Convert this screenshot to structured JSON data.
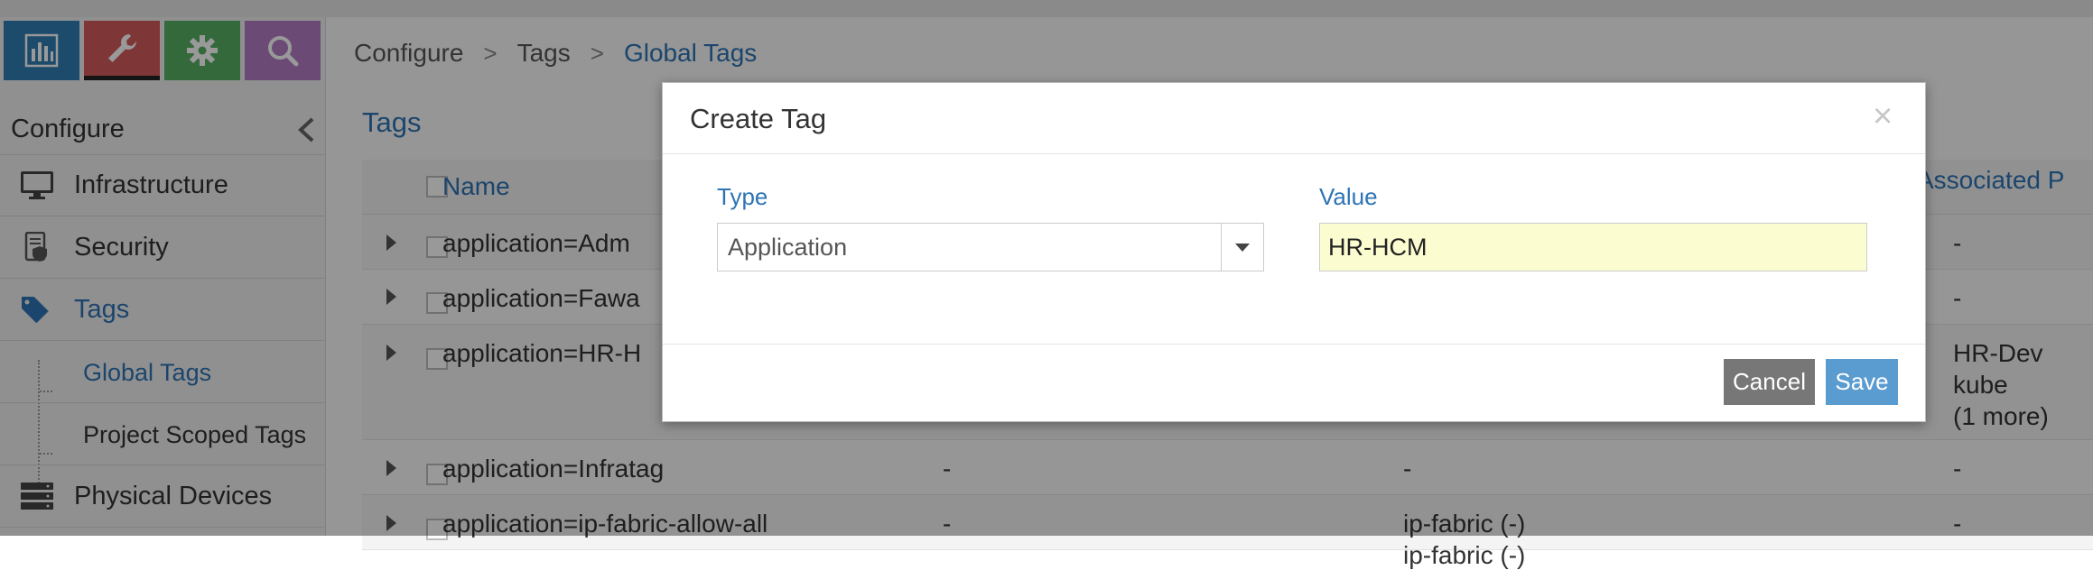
{
  "nav": {
    "header": "Configure",
    "icons": [
      "monitor-icon",
      "wrench-icon",
      "gear-icon",
      "search-icon"
    ],
    "items": [
      {
        "label": "Infrastructure",
        "icon": "monitor-icon"
      },
      {
        "label": "Security",
        "icon": "security-icon"
      },
      {
        "label": "Tags",
        "icon": "tag-icon"
      },
      {
        "label": "Physical Devices",
        "icon": "server-icon"
      }
    ],
    "subitems": [
      {
        "label": "Global Tags"
      },
      {
        "label": "Project Scoped Tags"
      }
    ]
  },
  "breadcrumb": {
    "items": [
      "Configure",
      "Tags",
      "Global Tags"
    ],
    "separator": ">"
  },
  "panel": {
    "title": "Tags"
  },
  "table": {
    "columns": {
      "name": "Name",
      "associated": "Associated P"
    },
    "rows": [
      {
        "name": "application=Adm",
        "col2": "",
        "col3": "",
        "assoc": "-"
      },
      {
        "name": "application=Fawa",
        "col2": "",
        "col3": "",
        "assoc": "-"
      },
      {
        "name": "application=HR-H",
        "col2": "",
        "col3": "",
        "assoc_lines": [
          "HR-Dev",
          "kube",
          "(1 more)"
        ]
      },
      {
        "name": "application=Infratag",
        "col2": "-",
        "col3": "-",
        "assoc": "-"
      },
      {
        "name": "application=ip-fabric-allow-all",
        "col2": "-",
        "col3_lines": [
          "ip-fabric (-)",
          "ip-fabric (-)"
        ],
        "assoc": "-"
      }
    ]
  },
  "modal": {
    "title": "Create Tag",
    "close": "×",
    "type_label": "Type",
    "type_value": "Application",
    "value_label": "Value",
    "value_value": "HR-HCM",
    "cancel": "Cancel",
    "save": "Save"
  },
  "colors": {
    "accent": "#2e74b5",
    "monitor": "#2f7eb3",
    "config": "#d25a5a",
    "settings": "#58b163",
    "query": "#b27dc3",
    "value_bg": "#fbfdd1"
  }
}
